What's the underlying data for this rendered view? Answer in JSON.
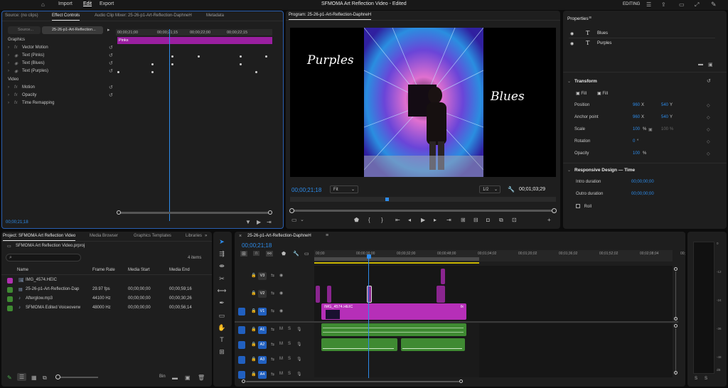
{
  "app": {
    "title": "SFMOMA Art Reflection Video - Edited",
    "menu": [
      "Import",
      "Edit",
      "Export"
    ],
    "workspace": "EDITING"
  },
  "colors": {
    "accent_blue": "#2d8ceb",
    "pink_clip": "#b62fb8",
    "green_audio": "#3f8a32",
    "track_blue": "#2160c0"
  },
  "source_panel": {
    "tabs": [
      "Source: (no clips)",
      "Effect Controls",
      "Audio Clip Mixer: 25-26-p1-Art-Reflection-DaphneH",
      "Metadata"
    ],
    "subtabs": [
      "Source...",
      "25-26-p1-Art-Reflection..."
    ],
    "ruler": [
      "00;00;21;00",
      "00;00;21;15",
      "00;00;22;00",
      "00;00;22;15"
    ],
    "clip_label": "Pinks",
    "sections": {
      "graphics": "Graphics",
      "video": "Video"
    },
    "rows_graphics": [
      "Vector Motion",
      "Text (Pinks)",
      "Text (Blues)",
      "Text (Purples)"
    ],
    "rows_video": [
      "Motion",
      "Opacity",
      "Time Remapping"
    ],
    "fx": "fx",
    "timecode": "00;00;21;18"
  },
  "program": {
    "title": "Program: 25-26-p1-Art-Reflection-DaphneH",
    "overlay_left": "Purples",
    "overlay_right": "Blues",
    "timecode": "00;00;21;18",
    "fit": "Fit",
    "quality": "1/2",
    "duration": "00;01;03;29"
  },
  "properties": {
    "title": "Properties",
    "layers": [
      "Blues",
      "Purples"
    ],
    "transform_title": "Transform",
    "fill": "Fill",
    "position": {
      "label": "Position",
      "x": "960",
      "y": "540",
      "xu": "X",
      "yu": "Y"
    },
    "anchor": {
      "label": "Anchor point",
      "x": "960",
      "y": "540",
      "xu": "X",
      "yu": "Y"
    },
    "scale": {
      "label": "Scale",
      "value": "100",
      "unit": "%",
      "value2": "100",
      "unit2": "%"
    },
    "rotation": {
      "label": "Rotation",
      "value": "0",
      "unit": "°"
    },
    "opacity": {
      "label": "Opacity",
      "value": "100",
      "unit": "%"
    },
    "responsive_title": "Responsive Design — Time",
    "intro": {
      "label": "Intro duration",
      "value": "00;00;00;00"
    },
    "outro": {
      "label": "Outro duration",
      "value": "00;00;00;00"
    },
    "roll": "Roll"
  },
  "project": {
    "tabs": [
      "Project: SFMOMA Art Reflection Video",
      "Media Browser",
      "Graphics Templates",
      "Libraries"
    ],
    "file": "SFMOMA Art Reflection Video.prproj",
    "count": "4 items",
    "columns": [
      "Name",
      "Frame Rate",
      "Media Start",
      "Media End"
    ],
    "items": [
      {
        "name": "IMG_4574.HEIC",
        "rate": "",
        "start": "",
        "end": "",
        "color": "#b030b0"
      },
      {
        "name": "25-26-p1-Art-Reflection-Dap",
        "rate": "29.97 fps",
        "start": "00;00;00;00",
        "end": "00;00;59;16",
        "color": "#3f8a32"
      },
      {
        "name": "Afterglow.mp3",
        "rate": "44100 Hz",
        "start": "00;00;00;00",
        "end": "00;00;30;26",
        "color": "#3f8a32"
      },
      {
        "name": "SFMOMA Edited Voiceoverw",
        "rate": "48000 Hz",
        "start": "00;00;00;00",
        "end": "00;00;56;14",
        "color": "#3f8a32"
      }
    ],
    "bin": "Bin"
  },
  "timeline": {
    "title": "25-26-p1-Art-Reflection-DaphneH",
    "timecode": "00;00;21;18",
    "ruler": [
      "00;00",
      "00;00;16;00",
      "00;00;32;00",
      "00;00;48;00",
      "00;01;04;02",
      "00;01;20;02",
      "00;01;36;02",
      "00;01;52;02",
      "00;02;08;04",
      "00;02;24;04"
    ],
    "video_tracks": [
      "V3",
      "V2",
      "V1"
    ],
    "audio_tracks": [
      "A1",
      "A2",
      "A3",
      "A4"
    ],
    "clip_v1": "IMG_4574.HEIC",
    "m": "M",
    "s": "S"
  },
  "meter": {
    "label": "dB"
  }
}
